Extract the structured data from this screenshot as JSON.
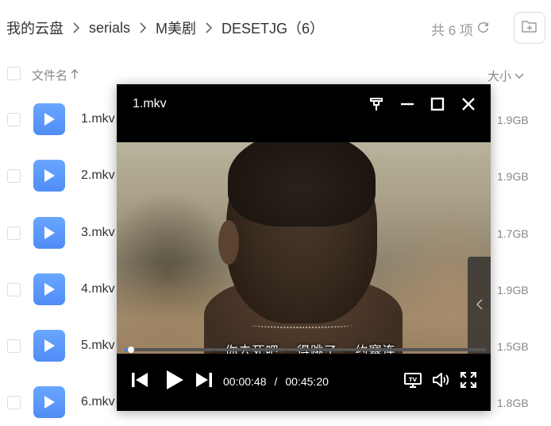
{
  "breadcrumb": [
    "我的云盘",
    "serials",
    "M美剧",
    "DESETJG（6）"
  ],
  "count": {
    "label": "共 6 项"
  },
  "list_header": {
    "name": "文件名",
    "size": "大小"
  },
  "files": [
    {
      "name": "1.mkv",
      "size": "1.9GB"
    },
    {
      "name": "2.mkv",
      "size": "1.9GB"
    },
    {
      "name": "3.mkv",
      "size": "1.7GB"
    },
    {
      "name": "4.mkv",
      "size": "1.9GB"
    },
    {
      "name": "5.mkv",
      "size": "1.5GB"
    },
    {
      "name": "6.mkv",
      "size": "1.8GB"
    }
  ],
  "player": {
    "title": "1.mkv",
    "subtitle": "一你去死吧 一得跳了 一约塞连",
    "current_time": "00:00:48",
    "separator": "/",
    "total_time": "00:45:20",
    "progress_fraction": 0.0176
  },
  "colors": {
    "accent": "#3f7cf3",
    "file_icon": "#5b97fb"
  }
}
